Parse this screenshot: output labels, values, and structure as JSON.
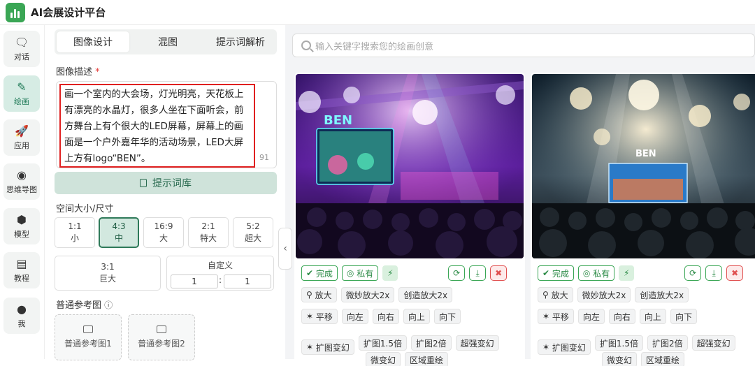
{
  "app": {
    "title": "AI会展设计平台"
  },
  "nav": [
    {
      "label": "对话",
      "icon": "chat-icon",
      "glyph": "🗨"
    },
    {
      "label": "绘画",
      "icon": "brush-icon",
      "glyph": "✎"
    },
    {
      "label": "应用",
      "icon": "rocket-icon",
      "glyph": "🚀"
    },
    {
      "label": "思维导图",
      "icon": "mindmap-icon",
      "glyph": "◉"
    },
    {
      "label": "模型",
      "icon": "cube-icon",
      "glyph": "⬢"
    },
    {
      "label": "教程",
      "icon": "book-icon",
      "glyph": "▤"
    },
    {
      "label": "我",
      "icon": "user-icon",
      "glyph": "●"
    }
  ],
  "panel": {
    "tabs": [
      "图像设计",
      "混图",
      "提示词解析"
    ],
    "desc_label": "图像描述",
    "required_mark": "*",
    "description": "画一个室内的大会场，灯光明亮，天花板上有漂亮的水晶灯，很多人坐在下面听会，前方舞台上有个很大的LED屏幕，屏幕上的画面是一个户外嘉年华的活动场景，LED大屏上方有logo“BEN”。",
    "char_count": "91",
    "prompt_lib_label": "提示词库",
    "size_label": "空间大小/尺寸",
    "sizes": [
      {
        "ratio": "1:1",
        "name": "小"
      },
      {
        "ratio": "4:3",
        "name": "中"
      },
      {
        "ratio": "16:9",
        "name": "大"
      },
      {
        "ratio": "2:1",
        "name": "特大"
      },
      {
        "ratio": "5:2",
        "name": "超大"
      }
    ],
    "size_31": {
      "ratio": "3:1",
      "name": "巨大"
    },
    "custom": {
      "label": "自定义",
      "w": "1",
      "h": "1",
      "sep": ":"
    },
    "ref_label": "普通参考图",
    "ref_info_icon": "ⓘ",
    "refs": [
      "普通参考图1",
      "普通参考图2"
    ]
  },
  "search": {
    "placeholder": "输入关键字搜索您的绘画创意"
  },
  "cards": [
    {
      "status": "完成",
      "privacy": "私有",
      "ops1": [
        "放大",
        "微妙放大2x",
        "创造放大2x"
      ],
      "ops2": [
        "平移",
        "向左",
        "向右",
        "向上",
        "向下"
      ],
      "ops3": [
        "扩图变幻",
        "扩图1.5倍",
        "扩图2倍",
        "超强变幻"
      ],
      "ops4": [
        "微变幻",
        "区域重绘"
      ]
    },
    {
      "status": "完成",
      "privacy": "私有",
      "ops1": [
        "放大",
        "微妙放大2x",
        "创造放大2x"
      ],
      "ops2": [
        "平移",
        "向左",
        "向右",
        "向上",
        "向下"
      ],
      "ops3": [
        "扩图变幻",
        "扩图1.5倍",
        "扩图2倍",
        "超强变幻"
      ],
      "ops4": [
        "微变幻",
        "区域重绘"
      ]
    }
  ],
  "screen_text": {
    "logo": "BEN"
  },
  "colors": {
    "accent": "#3aa655",
    "accent_dark": "#2f7a5a",
    "highlight": "#e02020"
  }
}
